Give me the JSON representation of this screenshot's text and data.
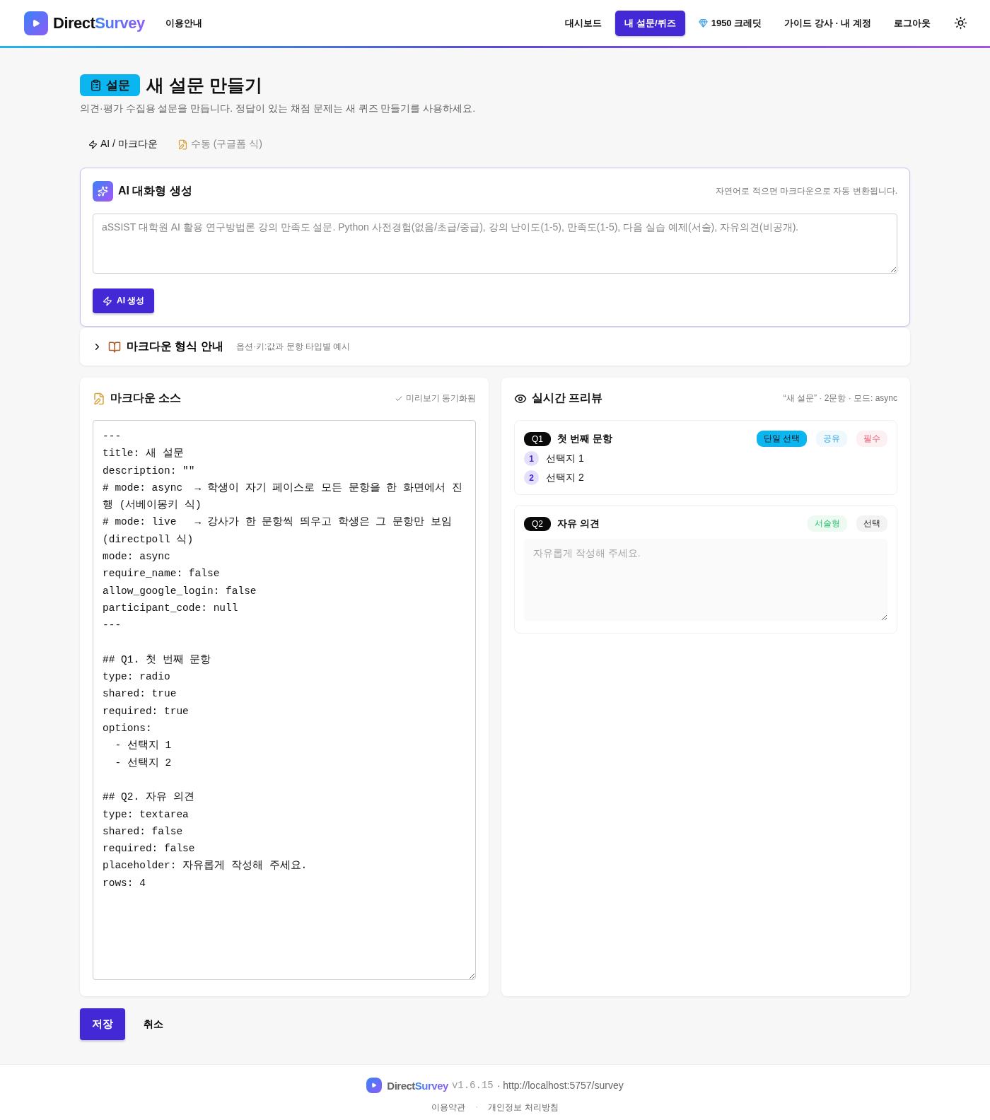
{
  "header": {
    "brand": {
      "part_1": "Direct",
      "part_2": "Survey"
    },
    "guide_link": "이용안내",
    "nav": [
      {
        "label": "대시보드",
        "selected": false,
        "kind": "link"
      },
      {
        "label": "내 설문/퀴즈",
        "selected": true,
        "kind": "link"
      },
      {
        "label": "1950 크레딧",
        "selected": false,
        "kind": "credits"
      },
      {
        "label": "가이드 강사 · 내 계정",
        "selected": false,
        "kind": "link"
      },
      {
        "label": "로그아웃",
        "selected": false,
        "kind": "link"
      }
    ]
  },
  "page": {
    "badge": "설문",
    "title": "새 설문 만들기",
    "subtitle": "의견·평가 수집용 설문을 만듭니다. 정답이 있는 채점 문제는 새 퀴즈 만들기를 사용하세요."
  },
  "mode_tabs": [
    {
      "label": "AI / 마크다운",
      "selected": true,
      "kind": "ai"
    },
    {
      "label": "수동 (구글폼 식)",
      "selected": false,
      "kind": "manual"
    }
  ],
  "ai_panel": {
    "title": "AI 대화형 생성",
    "hint": "자연어로 적으면 마크다운으로 자동 변환됩니다.",
    "placeholder": "aSSIST 대학원 AI 활용 연구방법론 강의 만족도 설문. Python 사전경험(없음/초급/중급), 강의 난이도(1-5), 만족도(1-5), 다음 실습 예제(서술), 자유의견(비공개).",
    "button": "AI 생성"
  },
  "format_guide": {
    "title": "마크다운 형식 안내",
    "subtitle": "옵션·키:값과 문항 타입별 예시",
    "expanded": false
  },
  "source_panel": {
    "title": "마크다운 소스",
    "status": "미리보기 동기화됨",
    "source": "---\ntitle: 새 설문\ndescription: \"\"\n# mode: async  → 학생이 자기 페이스로 모든 문항을 한 화면에서 진행 (서베이몽키 식)\n# mode: live   → 강사가 한 문항씩 띄우고 학생은 그 문항만 보임 (directpoll 식)\nmode: async\nrequire_name: false\nallow_google_login: false\nparticipant_code: null\n---\n\n## Q1. 첫 번째 문항\ntype: radio\nshared: true\nrequired: true\noptions:\n  - 선택지 1\n  - 선택지 2\n\n## Q2. 자유 의견\ntype: textarea\nshared: false\nrequired: false\nplaceholder: 자유롭게 작성해 주세요.\nrows: 4"
  },
  "preview_panel": {
    "title": "실시간 프리뷰",
    "summary": "“새 설문” · 2문항 · 모드: async",
    "questions": [
      {
        "number": "Q1",
        "title": "첫 번째 문항",
        "kind": "choice",
        "tags": [
          {
            "label": "단일 선택",
            "kind": "type"
          },
          {
            "label": "공유",
            "kind": "shared"
          },
          {
            "label": "필수",
            "kind": "required"
          }
        ],
        "options": [
          {
            "index": "1",
            "label": "선택지 1"
          },
          {
            "index": "2",
            "label": "선택지 2"
          }
        ]
      },
      {
        "number": "Q2",
        "title": "자유 의견",
        "kind": "text",
        "tags": [
          {
            "label": "서술형",
            "kind": "text"
          },
          {
            "label": "선택",
            "kind": "optional"
          }
        ],
        "placeholder": "자유롭게 작성해 주세요."
      }
    ]
  },
  "actions": {
    "save": "저장",
    "cancel": "취소"
  },
  "footer": {
    "brand": {
      "part_1": "Direct",
      "part_2": "Survey"
    },
    "version": "v1.6.15",
    "url": "· http://localhost:5757/survey",
    "links": [
      "이용약관",
      "개인정보 처리방침"
    ],
    "separator": "·"
  }
}
